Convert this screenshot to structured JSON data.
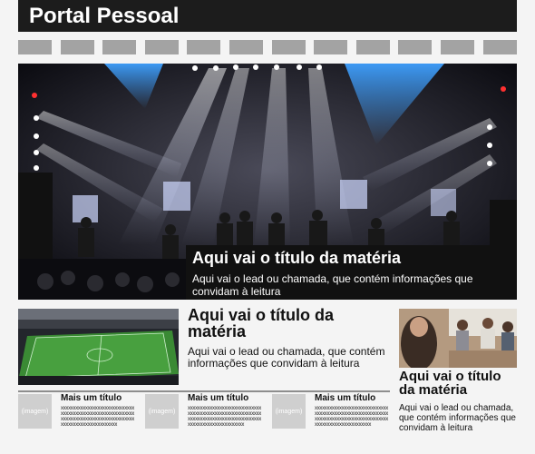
{
  "header": {
    "title": "Portal Pessoal"
  },
  "nav": {
    "tabs": [
      "",
      "",
      "",
      "",
      "",
      "",
      "",
      "",
      "",
      "",
      "",
      ""
    ]
  },
  "hero": {
    "image_icon": "concert-photo",
    "title": "Aqui vai o título da matéria",
    "lead": "Aqui vai o lead ou chamada, que contém informações que convidam à leitura"
  },
  "middle_story": {
    "image_icon": "stadium-photo",
    "title": "Aqui vai o título da matéria",
    "lead": "Aqui vai o lead ou chamada, que contém informações que convidam à leitura"
  },
  "right_story": {
    "image_icon": "group-people-photo",
    "title": "Aqui vai o título da matéria",
    "lead": "Aqui vai o lead ou chamada, que contém informações que convidam à leitura"
  },
  "cards": [
    {
      "image_label": "(imagem)",
      "title": "Mais um título",
      "body": "xxxxxxxxxxxxxxxxxxxxxxxxxxxxxxxxxxxxxxxxxxxxxxxxxxxxxxxxxxxxxxxxxxxxxxxxxxxxxxxxxxxxxxxxxxxxxxxxxxxxxxxxxxxxxxxxx"
    },
    {
      "image_label": "(imagem)",
      "title": "Mais um título",
      "body": "xxxxxxxxxxxxxxxxxxxxxxxxxxxxxxxxxxxxxxxxxxxxxxxxxxxxxxxxxxxxxxxxxxxxxxxxxxxxxxxxxxxxxxxxxxxxxxxxxxxxxxxxxxxxxxxxx"
    },
    {
      "image_label": "(imagem)",
      "title": "Mais um título",
      "body": "xxxxxxxxxxxxxxxxxxxxxxxxxxxxxxxxxxxxxxxxxxxxxxxxxxxxxxxxxxxxxxxxxxxxxxxxxxxxxxxxxxxxxxxxxxxxxxxxxxxxxxxxxxxxxxxxx"
    }
  ]
}
